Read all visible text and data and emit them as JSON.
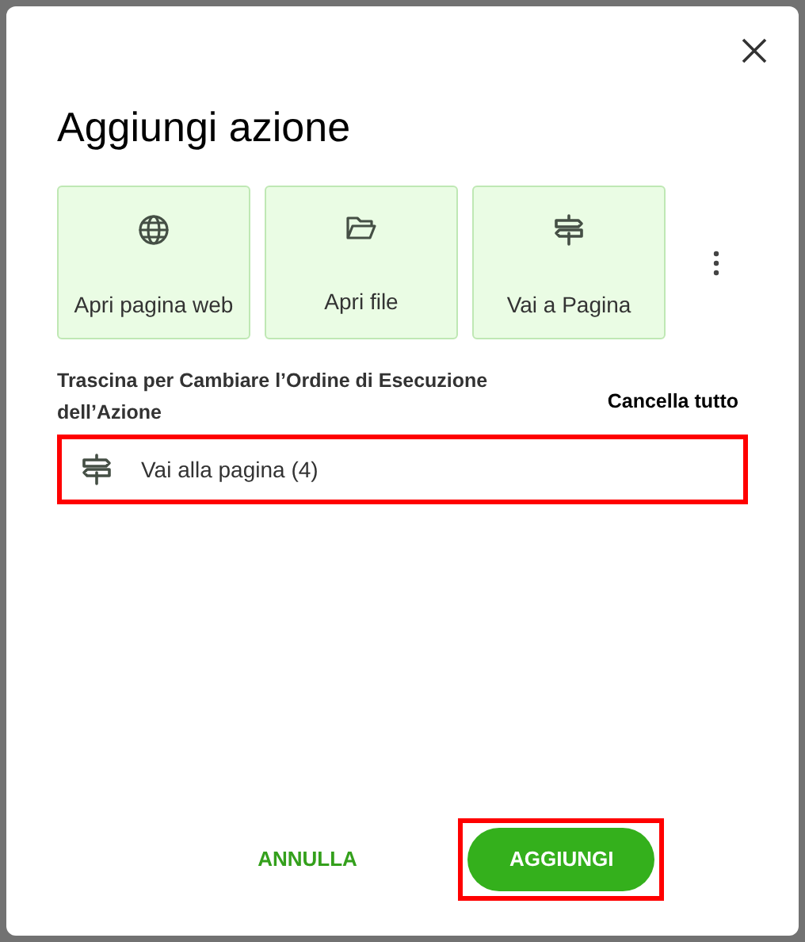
{
  "dialog": {
    "title": "Aggiungi azione"
  },
  "actions": [
    {
      "kind": "globe",
      "label": "Apri pagina web"
    },
    {
      "kind": "folder",
      "label": "Apri file"
    },
    {
      "kind": "signpost",
      "label": "Vai a Pagina"
    }
  ],
  "order": {
    "label": "Trascina per Cambiare l’Ordine di Esecuzione dell’Azione",
    "clear": "Cancella tutto",
    "items": [
      {
        "kind": "signpost",
        "label": "Vai alla pagina (4)",
        "highlighted": true
      }
    ]
  },
  "buttons": [
    {
      "kind": "text",
      "label": "ANNULLA",
      "highlighted": false
    },
    {
      "kind": "filled",
      "label": "AGGIUNGI",
      "highlighted": true
    }
  ]
}
